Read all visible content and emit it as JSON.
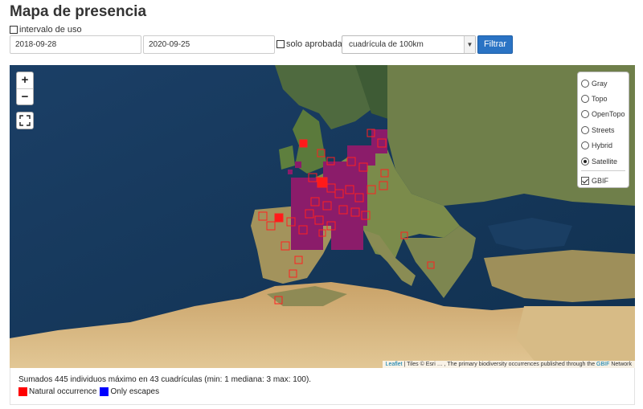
{
  "page": {
    "title": "Mapa de presencia"
  },
  "filters": {
    "intervalo_label": "intervalo de uso",
    "intervalo_checked": false,
    "date_from": "2018-09-28",
    "date_to": "2020-09-25",
    "solo_label": "solo aprobadas",
    "solo_checked": false,
    "grid_selected": "cuadrícula de 100km",
    "filter_button": "Filtrar"
  },
  "map": {
    "zoom_in": "+",
    "zoom_out": "−",
    "layers": [
      {
        "label": "Gray",
        "selected": false
      },
      {
        "label": "Topo",
        "selected": false
      },
      {
        "label": "OpenTopo",
        "selected": false
      },
      {
        "label": "Streets",
        "selected": false
      },
      {
        "label": "Hybrid",
        "selected": false
      },
      {
        "label": "Satellite",
        "selected": true
      }
    ],
    "overlay": {
      "label": "GBIF",
      "checked": true
    },
    "attribution": {
      "leaflet": "Leaflet",
      "tiles": " | Tiles © Esri … , The primary biodiversity occurrences published through the ",
      "gbif": "GBIF",
      "network": " Network"
    }
  },
  "summary": {
    "text": "Sumados 445 individuos máximo en 43 cuadrículas (min: 1 mediana: 3 max: 100).",
    "legend": [
      {
        "label": "Natural occurrence",
        "color": "#ff0000"
      },
      {
        "label": "Only escapes",
        "color": "#0000ff"
      }
    ]
  },
  "colors": {
    "accent": "#2a73c4",
    "occurrence": "#ff0000",
    "escape": "#0000ff"
  }
}
